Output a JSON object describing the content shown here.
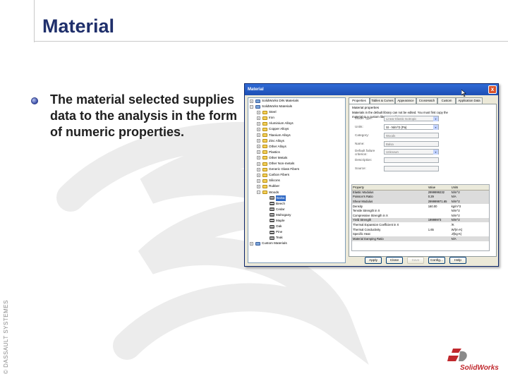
{
  "slide": {
    "title": "Material",
    "bullet": "The material selected supplies data to the analysis in the form of numeric properties.",
    "copyright": "© DASSAULT SYSTEMES",
    "logo_text": "SolidWorks"
  },
  "dialog": {
    "title": "Material",
    "close_label": "x",
    "tree": [
      {
        "label": "SolidWorks DIN Materials",
        "level": 0,
        "icon": "lib",
        "exp": "+"
      },
      {
        "label": "SolidWorks Materials",
        "level": 0,
        "icon": "lib",
        "exp": "−"
      },
      {
        "label": "Steel",
        "level": 1,
        "icon": "folder",
        "exp": "+"
      },
      {
        "label": "Iron",
        "level": 1,
        "icon": "folder",
        "exp": "+"
      },
      {
        "label": "Aluminium Alloys",
        "level": 1,
        "icon": "folder",
        "exp": "+"
      },
      {
        "label": "Copper Alloys",
        "level": 1,
        "icon": "folder",
        "exp": "+"
      },
      {
        "label": "Titanium Alloys",
        "level": 1,
        "icon": "folder",
        "exp": "+"
      },
      {
        "label": "Zinc Alloys",
        "level": 1,
        "icon": "folder",
        "exp": "+"
      },
      {
        "label": "Other Alloys",
        "level": 1,
        "icon": "folder",
        "exp": "+"
      },
      {
        "label": "Plastics",
        "level": 1,
        "icon": "folder",
        "exp": "+"
      },
      {
        "label": "Other Metals",
        "level": 1,
        "icon": "folder",
        "exp": "+"
      },
      {
        "label": "Other Non-metals",
        "level": 1,
        "icon": "folder",
        "exp": "+"
      },
      {
        "label": "Generic Glass Fibers",
        "level": 1,
        "icon": "folder",
        "exp": "+"
      },
      {
        "label": "Carbon Fibers",
        "level": 1,
        "icon": "folder",
        "exp": "+"
      },
      {
        "label": "Silicons",
        "level": 1,
        "icon": "folder",
        "exp": "+"
      },
      {
        "label": "Rubber",
        "level": 1,
        "icon": "folder",
        "exp": "+"
      },
      {
        "label": "Woods",
        "level": 1,
        "icon": "folder",
        "exp": "−"
      },
      {
        "label": "Balsa",
        "level": 2,
        "icon": "mat",
        "exp": "",
        "selected": true
      },
      {
        "label": "Beech",
        "level": 2,
        "icon": "mat",
        "exp": ""
      },
      {
        "label": "Cedar",
        "level": 2,
        "icon": "mat",
        "exp": ""
      },
      {
        "label": "Mahogany",
        "level": 2,
        "icon": "mat",
        "exp": ""
      },
      {
        "label": "Maple",
        "level": 2,
        "icon": "mat",
        "exp": ""
      },
      {
        "label": "Oak",
        "level": 2,
        "icon": "mat",
        "exp": ""
      },
      {
        "label": "Pine",
        "level": 2,
        "icon": "mat",
        "exp": ""
      },
      {
        "label": "Teak",
        "level": 2,
        "icon": "mat",
        "exp": ""
      },
      {
        "label": "Custom Materials",
        "level": 0,
        "icon": "lib",
        "exp": "+"
      }
    ],
    "tabs": [
      {
        "label": "Properties",
        "active": true
      },
      {
        "label": "Tables & Curves"
      },
      {
        "label": "Appearance"
      },
      {
        "label": "CrossHatch"
      },
      {
        "label": "Custom"
      },
      {
        "label": "Application Data"
      }
    ],
    "props": {
      "group_title": "Material properties",
      "note": "Materials in the default library can not be edited. You must first copy the material to a custom library to edit it.",
      "fields": [
        {
          "label": "Model Type:",
          "value": "Linear Elastic Isotropic",
          "combo": true
        },
        {
          "label": "Units:",
          "value": "SI - N/m^2 (Pa)",
          "combo": true
        },
        {
          "label": "Category:",
          "value": "Woods",
          "combo": false
        },
        {
          "label": "Name:",
          "value": "Balsa",
          "combo": false
        },
        {
          "label": "Default failure criterion:",
          "value": "Unknown",
          "combo": true
        },
        {
          "label": "Description:",
          "value": "",
          "combo": false
        },
        {
          "label": "Source:",
          "value": "",
          "combo": false
        }
      ],
      "table_headers": [
        "Property",
        "Value",
        "Units"
      ],
      "table_rows": [
        [
          "Elastic Modulus",
          "2999999232",
          "N/m^2"
        ],
        [
          "Poisson's Ratio",
          "0.29",
          "N/A"
        ],
        [
          "Shear Modulus",
          "299999971.65",
          "N/m^2"
        ],
        [
          "Density",
          "160.00",
          "kg/m^3"
        ],
        [
          "Tensile Strength in X",
          "",
          "N/m^2"
        ],
        [
          "Compressive Strength in X",
          "",
          "N/m^2"
        ],
        [
          "Yield Strength",
          "19999973",
          "N/m^2"
        ],
        [
          "Thermal Expansion Coefficient in X",
          "",
          "/K"
        ],
        [
          "Thermal Conductivity",
          "1.65",
          "W/(m·K)"
        ],
        [
          "Specific Heat",
          "",
          "J/(kg·K)"
        ],
        [
          "Material Damping Ratio",
          "",
          "N/A"
        ]
      ]
    },
    "buttons": [
      {
        "label": "Apply",
        "enabled": true
      },
      {
        "label": "Close",
        "enabled": true
      },
      {
        "label": "Save",
        "enabled": false
      },
      {
        "label": "Config...",
        "enabled": true
      },
      {
        "label": "Help",
        "enabled": true
      }
    ]
  }
}
